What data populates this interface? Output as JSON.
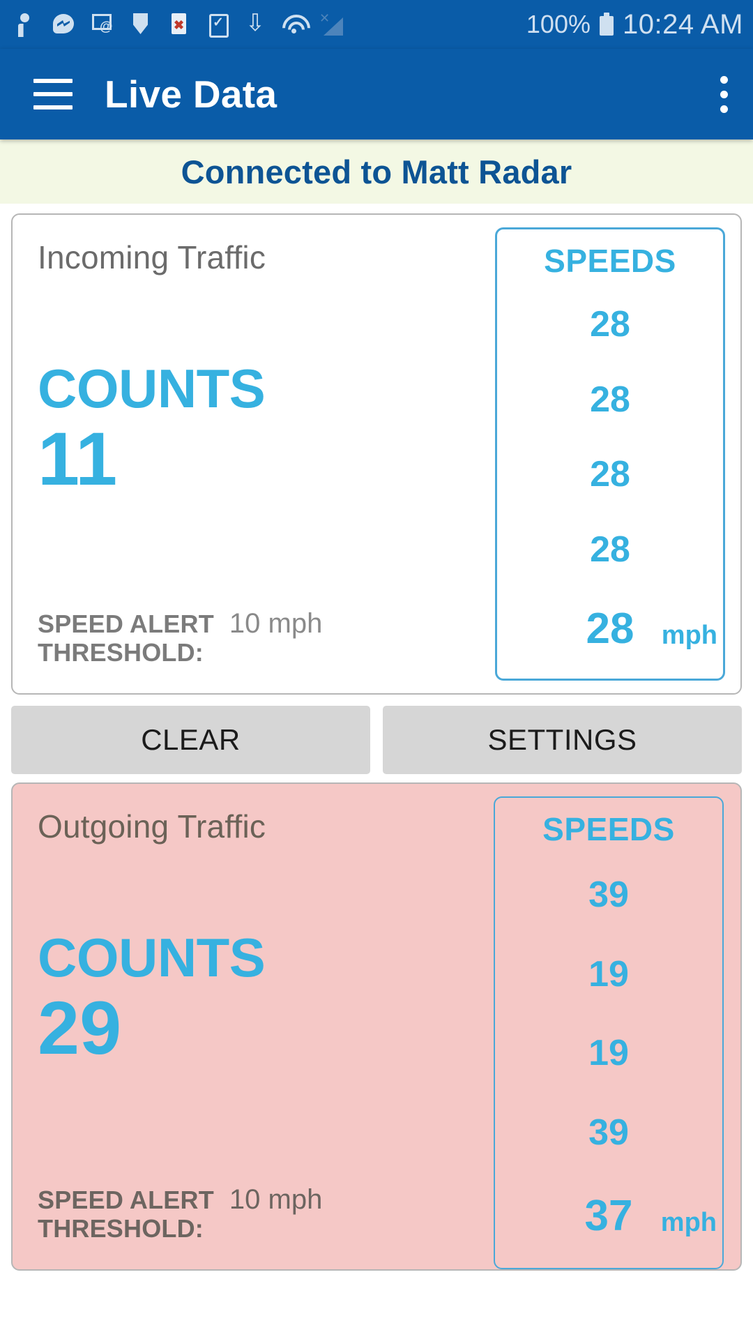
{
  "status_bar": {
    "icons": [
      "contact-icon",
      "messenger-icon",
      "mail-at-icon",
      "shield-icon",
      "document-error-icon",
      "clipboard-check-icon",
      "bluetooth-icon",
      "wifi-transfer-icon",
      "no-signal-icon"
    ],
    "battery_percent": "100%",
    "time": "10:24 AM"
  },
  "app_bar": {
    "menu_icon": "hamburger-menu-icon",
    "title": "Live Data",
    "overflow_icon": "more-vertical-icon"
  },
  "banner": {
    "text": "Connected to Matt Radar"
  },
  "incoming": {
    "direction_label": "Incoming Traffic",
    "counts_label": "COUNTS",
    "counts_value": "11",
    "threshold_label_line1": "SPEED ALERT",
    "threshold_label_line2": "THRESHOLD:",
    "threshold_value": "10 mph",
    "speeds_title": "SPEEDS",
    "speeds": [
      "28",
      "28",
      "28",
      "28",
      "28"
    ],
    "unit": "mph"
  },
  "actions": {
    "clear_label": "CLEAR",
    "settings_label": "SETTINGS"
  },
  "outgoing": {
    "direction_label": "Outgoing Traffic",
    "counts_label": "COUNTS",
    "counts_value": "29",
    "threshold_label_line1": "SPEED ALERT",
    "threshold_label_line2": "THRESHOLD:",
    "threshold_value": "10 mph",
    "speeds_title": "SPEEDS",
    "speeds": [
      "39",
      "19",
      "19",
      "39",
      "37"
    ],
    "unit": "mph"
  },
  "colors": {
    "app_bar_blue": "#0a5ca8",
    "accent_cyan": "#36b1e0",
    "banner_bg": "#f3f8e4",
    "banner_text": "#0d5494",
    "outgoing_bg": "#f5c8c6",
    "button_bg": "#d6d6d6"
  }
}
